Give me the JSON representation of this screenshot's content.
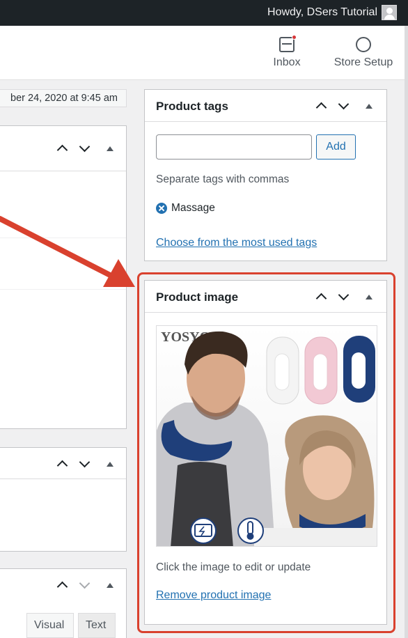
{
  "admin_bar": {
    "greeting": "Howdy, DSers Tutorial"
  },
  "header": {
    "inbox_label": "Inbox",
    "store_setup_label": "Store Setup"
  },
  "publish": {
    "date_text": "ber 24, 2020 at 9:45 am"
  },
  "editor": {
    "tab_visual": "Visual",
    "tab_text": "Text"
  },
  "product_tags": {
    "title": "Product tags",
    "input_value": "",
    "add_label": "Add",
    "hint": "Separate tags with commas",
    "tags": [
      "Massage"
    ],
    "choose_link": "Choose from the most used tags"
  },
  "product_image": {
    "title": "Product image",
    "image_watermark": "YOSYO",
    "caption": "Click the image to edit or update",
    "remove_link": "Remove product image"
  },
  "colors": {
    "highlight": "#d9412e",
    "link": "#2271b1",
    "product_navy": "#1f3f7a",
    "product_pink": "#f2c9d4"
  }
}
